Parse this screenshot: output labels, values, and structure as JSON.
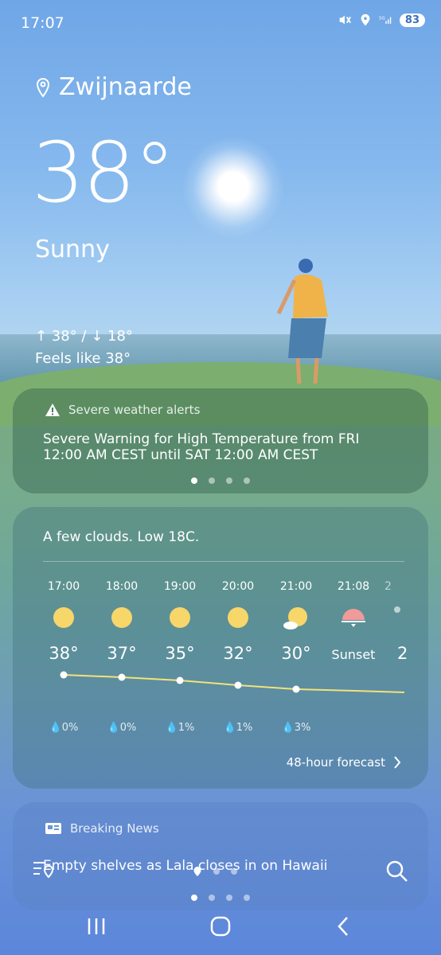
{
  "status_bar": {
    "time": "17:07",
    "battery": "83"
  },
  "location": {
    "name": "Zwijnaarde"
  },
  "current": {
    "temperature": "38°",
    "condition": "Sunny",
    "hi_lo": "↑ 38° / ↓ 18°",
    "feels_like": "Feels like 38°"
  },
  "alert": {
    "title": "Severe weather alerts",
    "text": "Severe Warning for High Temperature from FRI 12:00 AM CEST until SAT 12:00 AM CEST",
    "page_dots": 4,
    "active_dot": 0
  },
  "forecast": {
    "summary": "A few clouds. Low 18C.",
    "hours": [
      {
        "time": "17:00",
        "icon": "sun-icon",
        "temp": "38°",
        "precip": "0%"
      },
      {
        "time": "18:00",
        "icon": "sun-icon",
        "temp": "37°",
        "precip": "0%"
      },
      {
        "time": "19:00",
        "icon": "sun-icon",
        "temp": "35°",
        "precip": "1%"
      },
      {
        "time": "20:00",
        "icon": "sun-icon",
        "temp": "32°",
        "precip": "1%"
      },
      {
        "time": "21:00",
        "icon": "partly-cloudy-icon",
        "temp": "30°",
        "precip": "3%"
      },
      {
        "time": "21:08",
        "icon": "sunset-icon",
        "label": "Sunset"
      },
      {
        "time": "2",
        "temp": "2"
      }
    ],
    "link": "48-hour forecast"
  },
  "news": {
    "title": "Breaking News",
    "headline": "Empty shelves as Lala closes in on Hawaii",
    "page_dots": 4,
    "active_dot": 0
  },
  "colors": {
    "sun": "#f7d66a",
    "sunset": "#f09a9a",
    "trend_line": "#f3e27a"
  }
}
